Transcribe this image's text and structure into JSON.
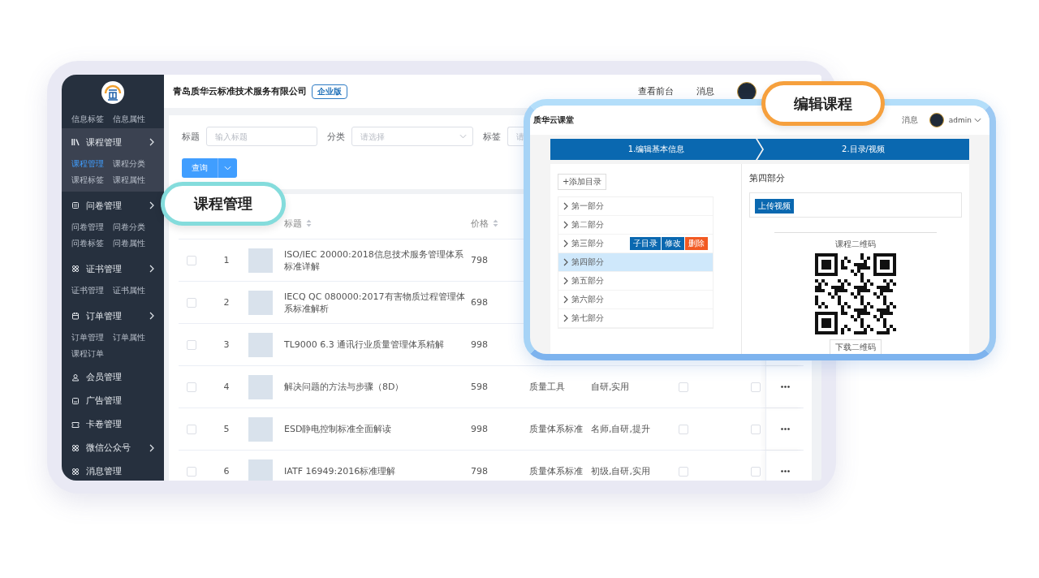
{
  "sidebar": {
    "top_links": [
      {
        "label": "信息标签",
        "selected": false
      },
      {
        "label": "信息属性",
        "selected": false
      }
    ],
    "groups": [
      {
        "label": "课程管理",
        "kind": "submenu",
        "selected": true,
        "children": [
          {
            "label": "课程管理",
            "selected": true
          },
          {
            "label": "课程分类",
            "selected": false
          },
          {
            "label": "课程标签",
            "selected": false
          },
          {
            "label": "课程属性",
            "selected": false
          }
        ]
      },
      {
        "label": "问卷管理",
        "kind": "submenu",
        "selected": false,
        "children": [
          {
            "label": "问卷管理",
            "selected": false
          },
          {
            "label": "问卷分类",
            "selected": false
          },
          {
            "label": "问卷标签",
            "selected": false
          },
          {
            "label": "问卷属性",
            "selected": false
          }
        ]
      },
      {
        "label": "证书管理",
        "kind": "submenu",
        "selected": false,
        "children": [
          {
            "label": "证书管理",
            "selected": false
          },
          {
            "label": "证书属性",
            "selected": false
          }
        ]
      },
      {
        "label": "订单管理",
        "kind": "submenu",
        "selected": false,
        "children": [
          {
            "label": "订单管理",
            "selected": false
          },
          {
            "label": "订单属性",
            "selected": false
          },
          {
            "label": "课程订单",
            "selected": false
          }
        ]
      },
      {
        "label": "会员管理",
        "kind": "item",
        "selected": false
      },
      {
        "label": "广告管理",
        "kind": "item",
        "selected": false
      },
      {
        "label": "卡卷管理",
        "kind": "item",
        "selected": false
      },
      {
        "label": "微信公众号",
        "kind": "submenu",
        "selected": false
      },
      {
        "label": "消息管理",
        "kind": "item",
        "selected": false
      }
    ]
  },
  "header": {
    "company": "青岛质华云标准技术服务有限公司",
    "edition_badge": "企业版",
    "links": [
      "查看前台",
      "消息"
    ]
  },
  "filters": [
    {
      "label": "标题",
      "placeholder": "输入标题",
      "kind": "input"
    },
    {
      "label": "分类",
      "placeholder": "请选择",
      "kind": "select"
    },
    {
      "label": "标签",
      "placeholder": "请",
      "kind": "input"
    }
  ],
  "query_button": "查询",
  "table": {
    "columns": [
      "标题",
      "价格"
    ],
    "rows": [
      {
        "checked": false,
        "index": "1",
        "title": "ISO/IEC 20000:2018信息技术服务管理体系标准详解",
        "price": "798"
      },
      {
        "checked": false,
        "index": "2",
        "title": "IECQ QC 080000:2017有害物质过程管理体系标准解析",
        "price": "698"
      },
      {
        "checked": false,
        "index": "3",
        "title": "TL9000 6.3 通讯行业质量管理体系精解",
        "price": "998"
      },
      {
        "checked": false,
        "index": "4",
        "title": "解决问题的方法与步骤（8D）",
        "price": "598",
        "category": "质量工具",
        "tags": "自研,实用",
        "column_8_checked": false,
        "column_9_checked": false
      },
      {
        "checked": false,
        "index": "5",
        "title": "ESD静电控制标准全面解读",
        "price": "998",
        "category": "质量体系标准",
        "tags": "名师,自研,提升",
        "column_8_checked": false,
        "column_9_checked": false
      },
      {
        "checked": false,
        "index": "6",
        "title": "IATF 16949:2016标准理解",
        "price": "798",
        "category": "质量体系标准",
        "tags": "初级,自研,实用",
        "column_8_checked": false,
        "column_9_checked": false
      }
    ]
  },
  "callout_left": "课程管理",
  "callout_right": "编辑课程",
  "editor_window": {
    "brand": "质华云课堂",
    "links": [
      "消息"
    ],
    "user": "admin",
    "steps": [
      "1.编辑基本信息",
      "2.目录/视频"
    ],
    "add_button": "+添加目录",
    "chapters": [
      {
        "label": "第一部分",
        "selected": false
      },
      {
        "label": "第二部分",
        "selected": false
      },
      {
        "label": "第三部分",
        "selected": false,
        "actions": [
          {
            "label": "子目录",
            "kind": "primary"
          },
          {
            "label": "修改",
            "kind": "primary"
          },
          {
            "label": "删除",
            "kind": "danger"
          }
        ]
      },
      {
        "label": "第四部分",
        "selected": true
      },
      {
        "label": "第五部分",
        "selected": false
      },
      {
        "label": "第六部分",
        "selected": false
      },
      {
        "label": "第七部分",
        "selected": false
      }
    ],
    "panel_title": "第四部分",
    "upload_button": "上传视频",
    "qr_label": "课程二维码",
    "download_button": "下载二维码"
  }
}
